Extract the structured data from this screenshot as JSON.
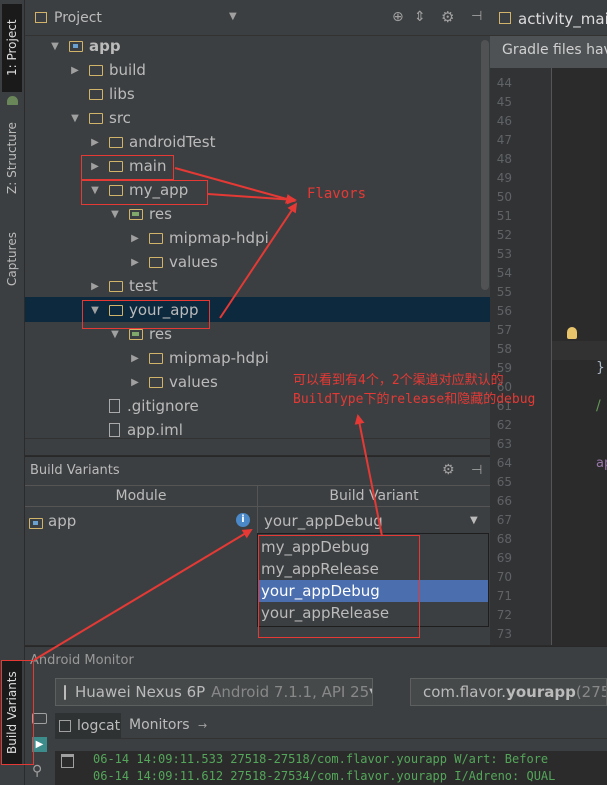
{
  "left_strip": {
    "project_tab": "1: Project",
    "structure_tab": "Z: Structure",
    "captures_tab": "Captures",
    "build_variants_tab": "Build Variants"
  },
  "project_panel": {
    "title": "Project",
    "tree": [
      {
        "label": "app",
        "arrow": "▼",
        "icon": "module-folder"
      },
      {
        "label": "build",
        "arrow": "▶",
        "icon": "folder"
      },
      {
        "label": "libs",
        "arrow": "",
        "icon": "folder"
      },
      {
        "label": "src",
        "arrow": "▼",
        "icon": "folder"
      },
      {
        "label": "androidTest",
        "arrow": "▶",
        "icon": "folder"
      },
      {
        "label": "main",
        "arrow": "▶",
        "icon": "folder"
      },
      {
        "label": "my_app",
        "arrow": "▼",
        "icon": "folder"
      },
      {
        "label": "res",
        "arrow": "▼",
        "icon": "res-folder"
      },
      {
        "label": "mipmap-hdpi",
        "arrow": "▶",
        "icon": "folder"
      },
      {
        "label": "values",
        "arrow": "▶",
        "icon": "folder"
      },
      {
        "label": "test",
        "arrow": "▶",
        "icon": "folder"
      },
      {
        "label": "your_app",
        "arrow": "▼",
        "icon": "folder"
      },
      {
        "label": "res",
        "arrow": "▼",
        "icon": "res-folder"
      },
      {
        "label": "mipmap-hdpi",
        "arrow": "▶",
        "icon": "folder"
      },
      {
        "label": "values",
        "arrow": "▶",
        "icon": "folder"
      },
      {
        "label": ".gitignore",
        "arrow": "",
        "icon": "file"
      },
      {
        "label": "app.iml",
        "arrow": "",
        "icon": "file"
      }
    ]
  },
  "editor": {
    "tab_label": "activity_main",
    "gradle_notice": "Gradle files hav",
    "line_numbers": [
      "44",
      "45",
      "46",
      "47",
      "48",
      "49",
      "50",
      "51",
      "52",
      "53",
      "54",
      "55",
      "56",
      "57",
      "58",
      "59",
      "60",
      "61",
      "62",
      "63",
      "64",
      "65",
      "66",
      "67",
      "68",
      "69",
      "70",
      "71",
      "72",
      "73"
    ],
    "code_fragments": {
      "brace": "}",
      "slash": "/",
      "ap": "ap"
    }
  },
  "build_variants": {
    "title": "Build Variants",
    "col_module": "Module",
    "col_variant": "Build Variant",
    "module": "app",
    "selected_variant": "your_appDebug",
    "options": [
      "my_appDebug",
      "my_appRelease",
      "your_appDebug",
      "your_appRelease"
    ]
  },
  "android_monitor": {
    "title": "Android Monitor",
    "device_name": "Huawei Nexus 6P",
    "device_detail": "Android 7.1.1, API 25",
    "process_prefix": "com.flavor.",
    "process_bold": "yourapp",
    "process_suffix": " (275",
    "tab_logcat": "logcat",
    "tab_monitors": "Monitors",
    "log_lines": [
      "06-14 14:09:11.533 27518-27518/com.flavor.yourapp W/art: Before",
      "06-14 14:09:11.612 27518-27534/com.flavor.yourapp I/Adreno: QUAL"
    ]
  },
  "annotations": {
    "flavors": "Flavors",
    "note_line1": "可以看到有4个，2个渠道对应默认的",
    "note_line2": "BuildType下的release和隐藏的debug"
  },
  "colors": {
    "annotation_red": "#e53935",
    "selection_blue": "#4b6eaf",
    "log_green": "#54a65a",
    "folder_yellow": "#d1b36a"
  }
}
